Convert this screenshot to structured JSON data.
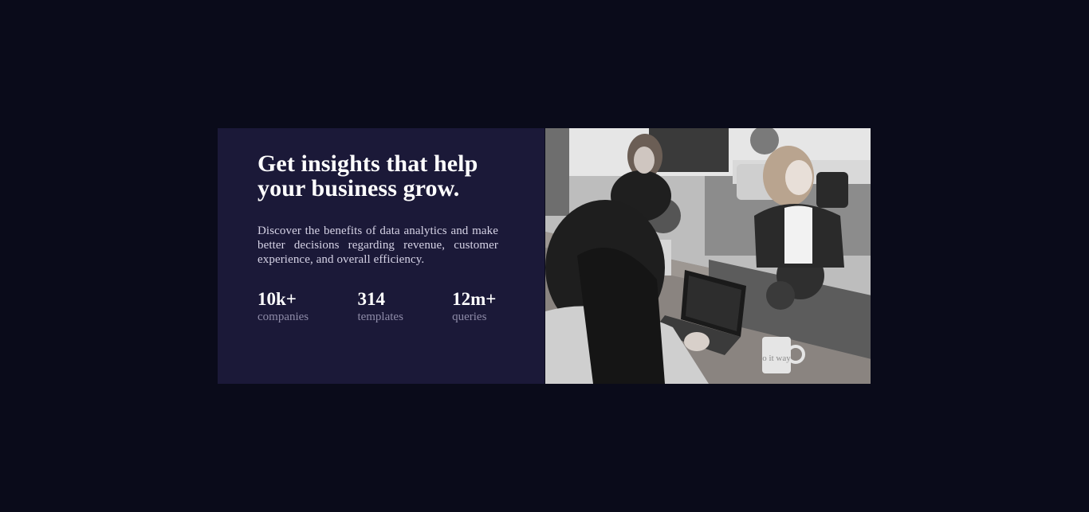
{
  "hero": {
    "headline_line1": "Get insights that help",
    "headline_line2": "your business grow.",
    "description": "Discover the benefits of data analytics and make better decisions regarding revenue, customer experience, and overall efficiency."
  },
  "stats": [
    {
      "value": "10k+",
      "label": "companies"
    },
    {
      "value": "314",
      "label": "templates"
    },
    {
      "value": "12m+",
      "label": "queries"
    }
  ],
  "image": {
    "description_icon": "office-photo",
    "mug_text": "o it way",
    "tone": "grayscale"
  },
  "colors": {
    "page_background": "#0a0b1a",
    "card_background": "#1b1938",
    "heading": "#ffffff",
    "body_text": "#d6d3e6",
    "stat_label": "#8e8ba8"
  }
}
